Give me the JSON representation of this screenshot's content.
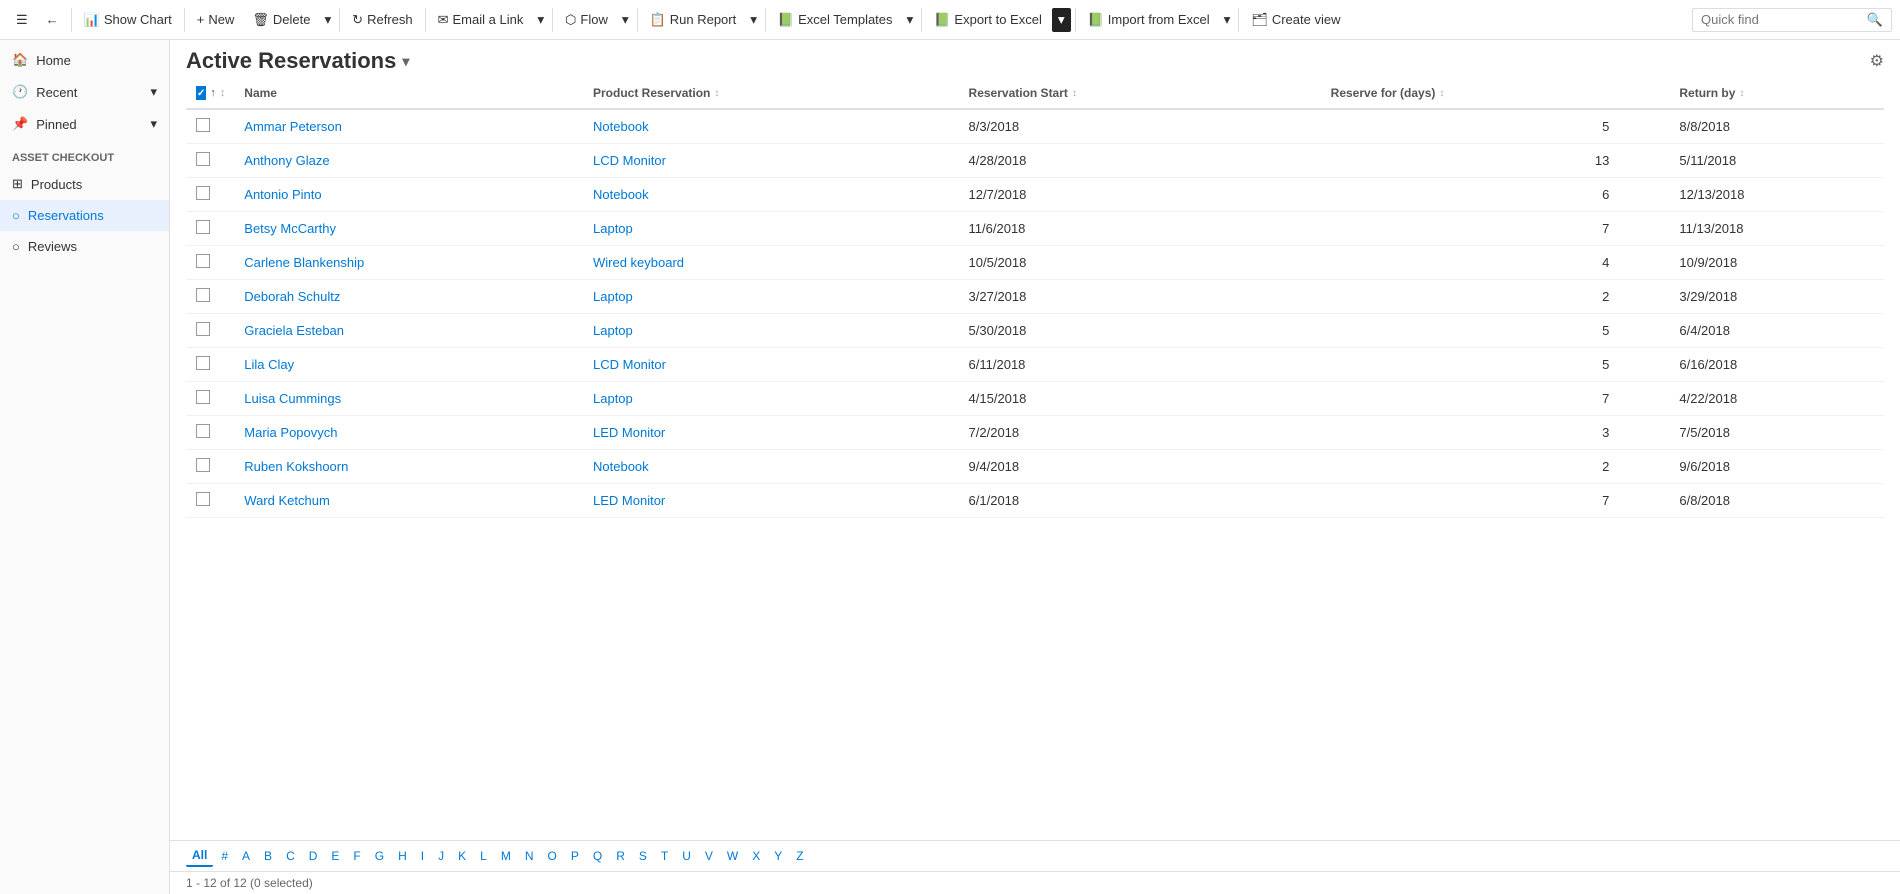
{
  "toolbar": {
    "show_chart_label": "Show Chart",
    "new_label": "New",
    "delete_label": "Delete",
    "refresh_label": "Refresh",
    "email_link_label": "Email a Link",
    "flow_label": "Flow",
    "run_report_label": "Run Report",
    "excel_templates_label": "Excel Templates",
    "export_to_excel_label": "Export to Excel",
    "import_from_excel_label": "Import from Excel",
    "create_view_label": "Create view",
    "quick_find_placeholder": "Quick find"
  },
  "sidebar": {
    "hamburger": "☰",
    "back_icon": "←",
    "home_label": "Home",
    "recent_label": "Recent",
    "pinned_label": "Pinned",
    "group_label": "Asset Checkout",
    "items": [
      {
        "id": "products",
        "label": "Products",
        "icon": "⊞"
      },
      {
        "id": "reservations",
        "label": "Reservations",
        "icon": "○",
        "active": true
      },
      {
        "id": "reviews",
        "label": "Reviews",
        "icon": "○"
      }
    ]
  },
  "view": {
    "title": "Active Reservations",
    "chevron": "▾"
  },
  "columns": [
    {
      "id": "name",
      "label": "Name",
      "sort": "↑",
      "sort_icon": "↕"
    },
    {
      "id": "product",
      "label": "Product Reservation",
      "sort_icon": "↕"
    },
    {
      "id": "start",
      "label": "Reservation Start",
      "sort_icon": "↕"
    },
    {
      "id": "days",
      "label": "Reserve for (days)",
      "sort_icon": "↕"
    },
    {
      "id": "return",
      "label": "Return by",
      "sort_icon": "↕"
    }
  ],
  "rows": [
    {
      "name": "Ammar Peterson",
      "product": "Notebook",
      "start": "8/3/2018",
      "days": "5",
      "return": "8/8/2018"
    },
    {
      "name": "Anthony Glaze",
      "product": "LCD Monitor",
      "start": "4/28/2018",
      "days": "13",
      "return": "5/11/2018"
    },
    {
      "name": "Antonio Pinto",
      "product": "Notebook",
      "start": "12/7/2018",
      "days": "6",
      "return": "12/13/2018"
    },
    {
      "name": "Betsy McCarthy",
      "product": "Laptop",
      "start": "11/6/2018",
      "days": "7",
      "return": "11/13/2018"
    },
    {
      "name": "Carlene Blankenship",
      "product": "Wired keyboard",
      "start": "10/5/2018",
      "days": "4",
      "return": "10/9/2018"
    },
    {
      "name": "Deborah Schultz",
      "product": "Laptop",
      "start": "3/27/2018",
      "days": "2",
      "return": "3/29/2018"
    },
    {
      "name": "Graciela Esteban",
      "product": "Laptop",
      "start": "5/30/2018",
      "days": "5",
      "return": "6/4/2018"
    },
    {
      "name": "Lila Clay",
      "product": "LCD Monitor",
      "start": "6/11/2018",
      "days": "5",
      "return": "6/16/2018"
    },
    {
      "name": "Luisa Cummings",
      "product": "Laptop",
      "start": "4/15/2018",
      "days": "7",
      "return": "4/22/2018"
    },
    {
      "name": "Maria Popovych",
      "product": "LED Monitor",
      "start": "7/2/2018",
      "days": "3",
      "return": "7/5/2018"
    },
    {
      "name": "Ruben Kokshoorn",
      "product": "Notebook",
      "start": "9/4/2018",
      "days": "2",
      "return": "9/6/2018"
    },
    {
      "name": "Ward Ketchum",
      "product": "LED Monitor",
      "start": "6/1/2018",
      "days": "7",
      "return": "6/8/2018"
    }
  ],
  "alpha_bar": {
    "active": "All",
    "letters": [
      "All",
      "#",
      "A",
      "B",
      "C",
      "D",
      "E",
      "F",
      "G",
      "H",
      "I",
      "J",
      "K",
      "L",
      "M",
      "N",
      "O",
      "P",
      "Q",
      "R",
      "S",
      "T",
      "U",
      "V",
      "W",
      "X",
      "Y",
      "Z"
    ]
  },
  "status_bar": {
    "text": "1 - 12 of 12 (0 selected)"
  }
}
